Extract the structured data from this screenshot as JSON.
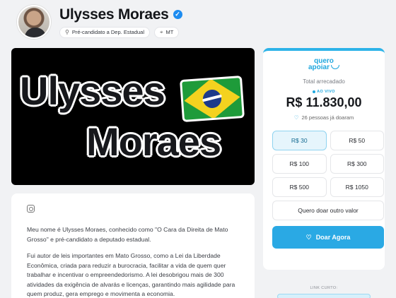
{
  "profile": {
    "name": "Ulysses Moraes",
    "role": "Pré-candidato a Dep. Estadual",
    "location": "MT"
  },
  "banner": {
    "line1": "Ulysses",
    "line2": "Moraes"
  },
  "content": {
    "paragraphs": [
      "Meu nome é Ulysses Moraes, conhecido como \"O Cara da Direita de Mato Grosso\" e pré-candidato a deputado estadual.",
      "Fui autor de leis importantes em Mato Grosso, como a Lei da Liberdade Econômica, criada para reduzir a burocracia, facilitar a vida de quem quer trabalhar e incentivar o empreendedorismo. A lei desobrigou mais de 300 atividades da exigência de alvarás e licenças, garantindo mais agilidade para quem produz, gera emprego e movimenta a economia."
    ]
  },
  "donation": {
    "logo_top": "quero",
    "logo_bottom": "apoiar",
    "total_label": "Total arrecadado",
    "live_label": "AO VIVO",
    "amount": "R$ 11.830,00",
    "donors": "26 pessoas já doaram",
    "options": [
      "R$ 30",
      "R$ 50",
      "R$ 100",
      "R$ 300",
      "R$ 500",
      "R$ 1050"
    ],
    "selected_option": "R$ 30",
    "custom_label": "Quero doar outro valor",
    "cta_label": "Doar Agora",
    "footer_label": "LINK CURTO:"
  },
  "colors": {
    "accent": "#2aa9e4",
    "verified": "#1d8cf0"
  }
}
